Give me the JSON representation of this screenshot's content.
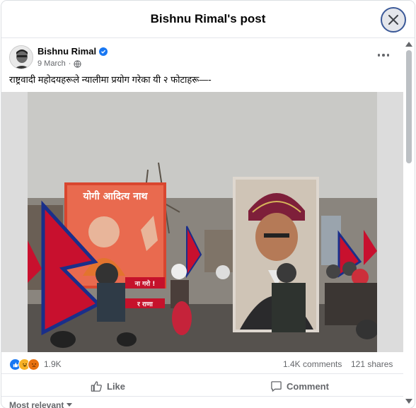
{
  "modal": {
    "title": "Bishnu Rimal's post"
  },
  "post": {
    "author": "Bishnu Rimal",
    "date": "9 March",
    "audience_icon": "globe-icon",
    "text": "राष्ट्रवादी महोदयहरूले न्यालीमा प्रयोग गरेका यी २ फोटाहरू—-",
    "photo": {
      "left_banner_title": "योगी आदित्य नाथ",
      "left_banner_bottom_1": "ना गरो !",
      "left_banner_bottom_2": "र राणा"
    }
  },
  "stats": {
    "reaction_icons": [
      "like-icon",
      "haha-icon",
      "angry-icon"
    ],
    "reactions_count": "1.9K",
    "comments": "1.4K comments",
    "shares": "121 shares"
  },
  "actions": {
    "like_label": "Like",
    "comment_label": "Comment"
  },
  "comments": {
    "sort_label": "Most relevant"
  },
  "colors": {
    "accent": "#1877f2",
    "flag_red": "#c8102e",
    "flag_blue": "#1a2f8a"
  }
}
